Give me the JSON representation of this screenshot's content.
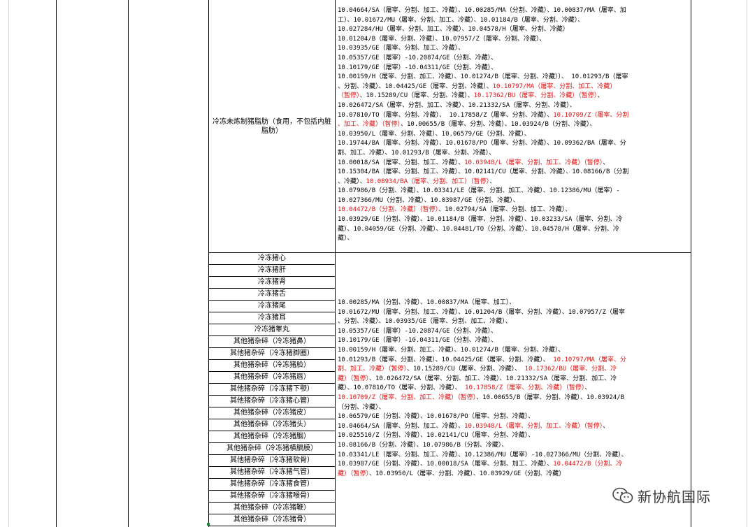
{
  "section1": {
    "name": "冷冻未炼制猪脂肪（食用，不包括内脏脂肪）",
    "lines": [
      [
        {
          "t": "10.04664/SA（屠宰、分割、加工、冷藏）、10.00285/MA（分割、冷藏）、10.00837/MA（屠宰、加"
        }
      ],
      [
        {
          "t": "工）、10.01672/MU（屠宰、分割、加工、冷藏）、10.01184/B（屠宰、分割、冷藏）、"
        }
      ],
      [
        {
          "t": "10.027284/HU（屠宰、分割、加工、冷藏）、10.04578/H（屠宰、分割、冷藏）"
        }
      ],
      [
        {
          "t": "10.01204/B（屠宰、分割、冷藏）、10.07957/Z（屠宰、分割、冷藏）、"
        }
      ],
      [
        {
          "t": "10.03935/GE（屠宰、分割、加工、冷藏）、"
        }
      ],
      [
        {
          "t": "10.05357/GE（屠宰）-10.20874/GE（分割、冷藏）、"
        }
      ],
      [
        {
          "t": "10.10179/GE（屠宰）-10.04311/GE（分割、冷藏）、"
        }
      ],
      [
        {
          "t": "10.00159/H（屠宰、分割、加工、冷藏）、10.01274/B（屠宰、分割、冷藏））、 10.01293/B（屠宰"
        }
      ],
      [
        {
          "t": "、分割、冷藏）、10.04425/GE（屠宰、分割、冷藏）、"
        },
        {
          "t": "10.10797/MA（屠宰、分割、加工、冷藏）",
          "r": true
        }
      ],
      [
        {
          "t": "（暂停）",
          "r": true
        },
        {
          "t": "、10.15289/CU（屠宰、分割、冷藏）、"
        },
        {
          "t": "10.17362/BU（屠宰、分割、冷藏）（暂停）",
          "r": true
        },
        {
          "t": "、"
        }
      ],
      [
        {
          "t": "10.026472/SA（屠宰、分割、加工、冷藏）、10.21332/SA（屠宰、分割、冷藏）、"
        }
      ],
      [
        {
          "t": "10.07810/TO（屠宰、分割、冷藏）、 10.17858/Z（屠宰、分割、冷藏）、"
        },
        {
          "t": "10.10709/Z（屠宰、分割",
          "r": true
        }
      ],
      [
        {
          "t": "、加工、冷藏）（暂停）",
          "r": true
        },
        {
          "t": "、10.00655/B（屠宰、分割、冷藏）、10.03924/B（分割、冷藏）、"
        }
      ],
      [
        {
          "t": "10.03950/L（屠宰、分割、冷藏）、10.06579/GE（分割、冷藏）、"
        }
      ],
      [
        {
          "t": "10.19744/BA（屠宰、分割、冷藏）、10.01678/PO（屠宰、分割、冷藏）、10.09362/BA（屠宰、分"
        }
      ],
      [
        {
          "t": "割、加工、冷藏）、10.01293/B（屠宰、分割、冷藏）、"
        }
      ],
      [
        {
          "t": "10.00018/SA（屠宰、分割、加工、冷藏）、"
        },
        {
          "t": "10.03948/L（屠宰、分割、加工、冷藏）（暂停）",
          "r": true
        },
        {
          "t": "、"
        }
      ],
      [
        {
          "t": "10.15304/BA（屠宰、分割、加工、冷藏）、10.02141/CU（屠宰、分割、冷藏）、10.08166/B（分割"
        }
      ],
      [
        {
          "t": "、冷藏）、"
        },
        {
          "t": "10.08934/BA（屠宰、分割、加工）（暂停）",
          "r": true
        },
        {
          "t": "、"
        }
      ],
      [
        {
          "t": "10.07986/B（分割、冷藏）、10.03341/LE（屠宰、分割、加工、冷藏）、10.12386/MU（屠宰）-"
        }
      ],
      [
        {
          "t": "10.027366/MU（分割、冷藏）、10.03987/GE（分割、冷藏）、"
        }
      ],
      [
        {
          "t": "10.04472/B（分割、冷藏）（暂停）",
          "r": true
        },
        {
          "t": "、10.02794/SA（屠宰、分割、加工、冷藏）、"
        }
      ],
      [
        {
          "t": "10.03929/GE（分割、冷藏）、10.01184/B（屠宰、分割、冷藏）、10.03233/SA（屠宰、分割、冷"
        }
      ],
      [
        {
          "t": "藏）、10.04059/GE（分割、冷藏）、10.04481/TO（分割、冷藏）、10.04578/H（屠宰、分割、冷"
        }
      ],
      [
        {
          "t": "藏）、"
        }
      ]
    ]
  },
  "section2": {
    "items": [
      "冷冻猪心",
      "冷冻猪肝",
      "冷冻猪肾",
      "冷冻猪舌",
      "冷冻猪尾",
      "冷冻猪耳",
      "冷冻猪睾丸",
      "其他猪杂碎（冷冻猪鼻）",
      "其他猪杂碎（冷冻猪脚圈）",
      "其他猪杂碎（冷冻猪脸）",
      "其他猪杂碎（冷冻猪唇）",
      "其他猪杂碎（冷冻猪下颚）",
      "其他猪杂碎（冷冻猪心管）",
      "其他猪杂碎（冷冻猪皮）",
      "其他猪杂碎（冷冻猪头）",
      "其他猪杂碎（冷冻猪胭）",
      "其他猪杂碎（冷冻猪横膈膜）",
      "其他猪杂碎（冷冻猪软骨）",
      "其他猪杂碎（冷冻猪气管）",
      "其他猪杂碎（冷冻猪食管）",
      "其他猪杂碎（冷冻猪喉骨）",
      "其他猪杂碎（冷冻猪鞭）",
      "其他猪杂碎（冷冻猪骨）"
    ],
    "lines": [
      [
        {
          "t": "10.00285/MA（分割、冷藏）、10.00837/MA（屠宰、加工）、"
        }
      ],
      [
        {
          "t": " 10.01672/MU（屠宰、分割、加工、冷藏）、10.01204/B（屠宰、分割、冷藏）、10.07957/Z（屠宰"
        }
      ],
      [
        {
          "t": "、分割、冷藏）、10.03935/GE（屠宰、分割、加工、冷藏）、"
        }
      ],
      [
        {
          "t": "10.05357/GE（屠宰）-10.20874/GE（分割、冷藏）、"
        }
      ],
      [
        {
          "t": "10.10179/GE（屠宰）-10.04311/GE（分割、冷藏）、"
        }
      ],
      [
        {
          "t": "10.00159/H（屠宰、分割、加工、冷藏）、10.01274/B（屠宰、分割、冷藏）、"
        }
      ],
      [
        {
          "t": "10.01293/B（屠宰、分割、冷藏）、10.04425/GE（屠宰、分割、冷藏）、 "
        },
        {
          "t": "10.10797/MA（屠宰、分",
          "r": true
        }
      ],
      [
        {
          "t": "割、加工、冷藏）（暂停）",
          "r": true
        },
        {
          "t": "、10.15289/CU（屠宰、分割、冷藏）、 "
        },
        {
          "t": "10.17362/BU（屠宰、分割、冷",
          "r": true
        }
      ],
      [
        {
          "t": "藏）（暂停）",
          "r": true
        },
        {
          "t": "、10.026472/SA（屠宰、分割、加工、冷藏）、10.21332/SA（屠宰、分割、加工、冷"
        }
      ],
      [
        {
          "t": "藏）、10.07810/TO（屠宰、分割、冷藏）、 "
        },
        {
          "t": "10.17858/Z（屠宰、分割、冷藏）（暂停）",
          "r": true
        },
        {
          "t": "、"
        }
      ],
      [
        {
          "t": "10.10709/Z（屠宰、分割、加工、冷藏）（暂停）",
          "r": true
        },
        {
          "t": "、10.00655/B（屠宰、分割、冷藏）、10.03924/B"
        }
      ],
      [
        {
          "t": "（分割、冷藏）、"
        }
      ],
      [
        {
          "t": "10.06579/GE（分割、冷藏）、10.01678/PO（屠宰、分割、冷藏）、"
        }
      ],
      [
        {
          "t": "10.04664/SA（屠宰、分割、加工、冷藏）、"
        },
        {
          "t": "10.03948/L（屠宰、分割、加工、冷藏）（暂停）",
          "r": true
        },
        {
          "t": "、"
        }
      ],
      [
        {
          "t": "10.025510/Z（分割、冷藏）、10.02141/CU（屠宰、分割、冷藏）、"
        }
      ],
      [
        {
          "t": "10.08166/B（分割、冷藏）、10.07986/B（分割、冷藏）、"
        }
      ],
      [
        {
          "t": "10.03341/LE（屠宰、分割、加工、冷藏）、10.12386/MU（屠宰）-10.027366/MU（分割、冷藏）、"
        }
      ],
      [
        {
          "t": "10.03987/GE（分割、冷藏）、10.00018/SA（屠宰、分割、加工、冷藏）、"
        },
        {
          "t": "10.04472/B（分割、冷",
          "r": true
        }
      ],
      [
        {
          "t": "藏）（暂停）",
          "r": true
        },
        {
          "t": "、10.03950/L（屠宰、分割、冷藏）、10.03929/GE（分割、冷藏）"
        }
      ]
    ]
  },
  "watermark": {
    "icon": "wechat-icon",
    "text": "新协航国际"
  },
  "colors": {
    "text": "#000000",
    "suspended": "#e01010",
    "grid": "#000000",
    "light_grid": "#d4d4d4"
  }
}
